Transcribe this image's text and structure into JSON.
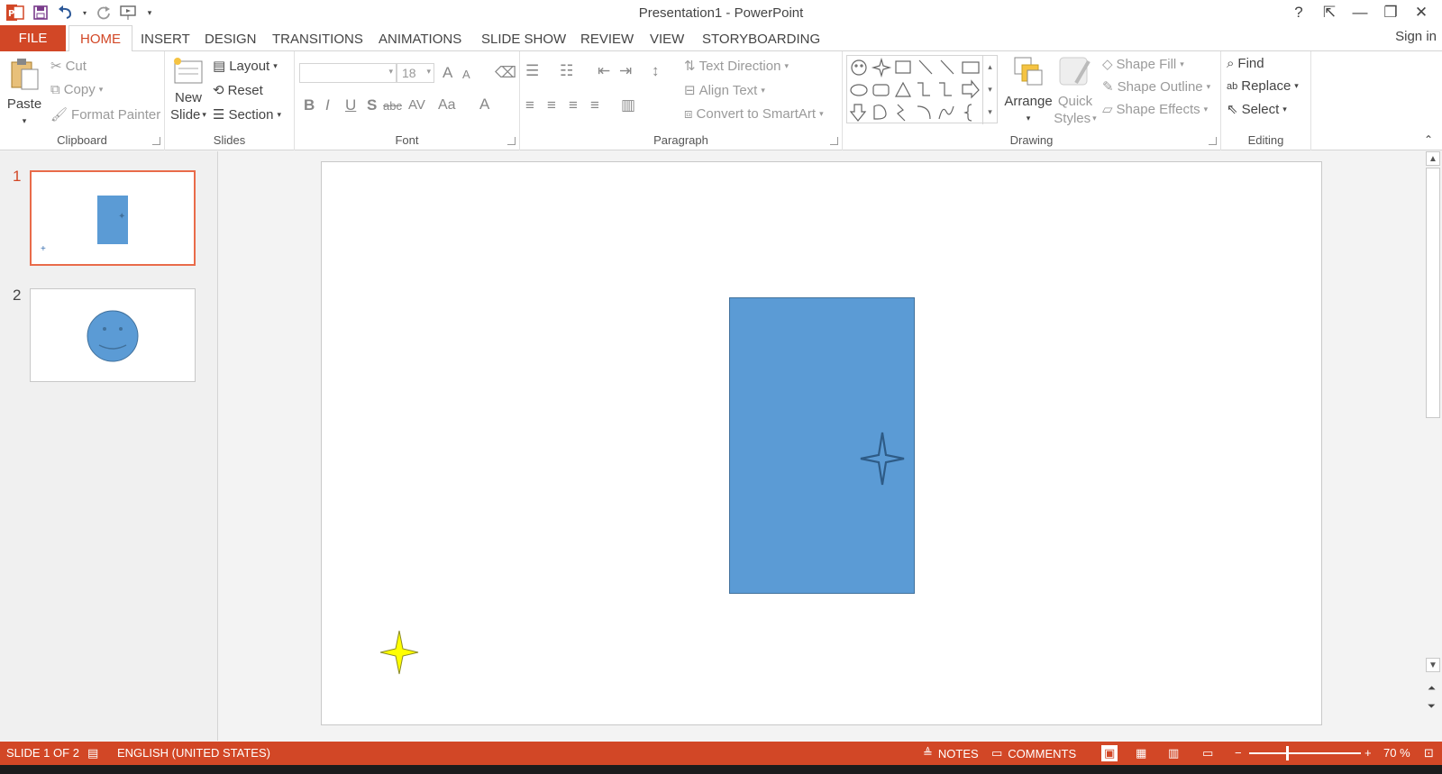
{
  "window": {
    "title": "Presentation1 - PowerPoint",
    "help": "?",
    "controls": [
      "⇱",
      "—",
      "❐",
      "✕"
    ]
  },
  "tabs": {
    "file": "FILE",
    "items": [
      "HOME",
      "INSERT",
      "DESIGN",
      "TRANSITIONS",
      "ANIMATIONS",
      "SLIDE SHOW",
      "REVIEW",
      "VIEW",
      "STORYBOARDING"
    ],
    "active": "HOME",
    "signin": "Sign in"
  },
  "ribbon": {
    "clipboard": {
      "label": "Clipboard",
      "paste": "Paste",
      "cut": "Cut",
      "copy": "Copy",
      "format_painter": "Format Painter"
    },
    "slides": {
      "label": "Slides",
      "new_slide_1": "New",
      "new_slide_2": "Slide",
      "layout": "Layout",
      "reset": "Reset",
      "section": "Section"
    },
    "font": {
      "label": "Font",
      "font_name": "",
      "font_size": "18",
      "bold": "B",
      "italic": "I",
      "underline": "U",
      "shadow": "S",
      "strike": "abc",
      "spacing": "AV",
      "case": "Aa",
      "color": "A",
      "grow": "A",
      "shrink": "A"
    },
    "paragraph": {
      "label": "Paragraph",
      "text_direction": "Text Direction",
      "align_text": "Align Text",
      "convert": "Convert to SmartArt"
    },
    "drawing": {
      "label": "Drawing",
      "arrange": "Arrange",
      "quick_1": "Quick",
      "quick_2": "Styles",
      "shape_fill": "Shape Fill",
      "shape_outline": "Shape Outline",
      "shape_effects": "Shape Effects"
    },
    "editing": {
      "label": "Editing",
      "find": "Find",
      "replace": "Replace",
      "select": "Select"
    }
  },
  "slides_pane": {
    "slides": [
      {
        "number": "1",
        "selected": true,
        "content": "blue rectangle with star"
      },
      {
        "number": "2",
        "selected": false,
        "content": "smiley face"
      }
    ]
  },
  "slide": {
    "rectangle_color": "#5b9bd5",
    "star_color": "#ffff00",
    "accent": "#d24726"
  },
  "status": {
    "slide_count": "SLIDE 1 OF 2",
    "language": "ENGLISH (UNITED STATES)",
    "notes": "NOTES",
    "comments": "COMMENTS",
    "zoom": "70 %",
    "zoom_level": 0.7
  }
}
